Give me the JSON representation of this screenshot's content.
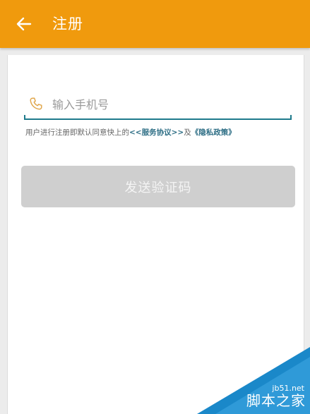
{
  "appbar": {
    "title": "注册",
    "back_icon": "arrow-left-icon",
    "color": "#f09a0d"
  },
  "form": {
    "phone": {
      "icon": "phone-icon",
      "placeholder": "输入手机号",
      "value": ""
    },
    "terms": {
      "prefix": "用户进行注册即默认同意快上的",
      "service_link": "<<服务协议>>",
      "joiner": "及",
      "privacy_link": "《隐私政策》"
    },
    "send_button_label": "发送验证码"
  },
  "watermark": {
    "url": "jb51.net",
    "name": "脚本之家"
  },
  "colors": {
    "accent": "#f09a0d",
    "link": "#2f6f86",
    "underline": "#1f7a8c",
    "disabled_button": "#cfcfcf"
  }
}
